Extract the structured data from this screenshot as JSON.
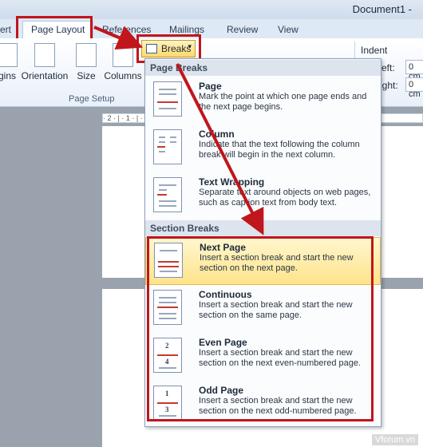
{
  "window": {
    "title": "Document1 -"
  },
  "tabs": [
    {
      "label": "ert"
    },
    {
      "label": "Page Layout"
    },
    {
      "label": "References"
    },
    {
      "label": "Mailings"
    },
    {
      "label": "Review"
    },
    {
      "label": "View"
    }
  ],
  "ribbon": {
    "buttons": [
      {
        "label": "gins"
      },
      {
        "label": "Orientation"
      },
      {
        "label": "Size"
      },
      {
        "label": "Columns"
      }
    ],
    "group_label": "Page Setup",
    "breaks_label": "Breaks",
    "indent_label": "Indent",
    "left_label": "eft:",
    "right_label": "ight:",
    "left_value": "0 cm",
    "right_value": "0 cm"
  },
  "ruler_text": "· 2 · | · 1 · | · · · · · · · · · · · · · · · · · · · · · · · · · 4 · | · 1",
  "menu": {
    "page_breaks_header": "Page Breaks",
    "section_breaks_header": "Section Breaks",
    "items": [
      {
        "title": "Page",
        "desc": "Mark the point at which one page ends and the next page begins."
      },
      {
        "title": "Column",
        "desc": "Indicate that the text following the column break will begin in the next column."
      },
      {
        "title": "Text Wrapping",
        "desc": "Separate text around objects on web pages, such as caption text from body text."
      },
      {
        "title": "Next Page",
        "desc": "Insert a section break and start the new section on the next page."
      },
      {
        "title": "Continuous",
        "desc": "Insert a section break and start the new section on the same page."
      },
      {
        "title": "Even Page",
        "desc": "Insert a section break and start the new section on the next even-numbered page."
      },
      {
        "title": "Odd Page",
        "desc": "Insert a section break and start the new section on the next odd-numbered page."
      }
    ]
  },
  "watermark": "Vforum.vn",
  "colors": {
    "highlight_border": "#c0161c",
    "selected_item": "#ffe38a"
  }
}
